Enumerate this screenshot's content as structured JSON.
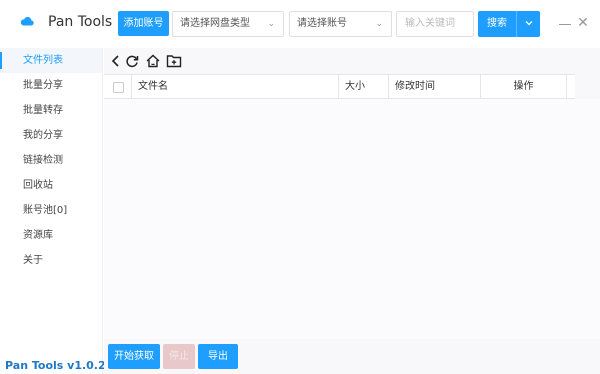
{
  "header": {
    "app_title": "Pan Tools",
    "add_account_label": "添加账号",
    "pan_type_select": {
      "value": "请选择网盘类型"
    },
    "account_select": {
      "value": "请选择账号"
    },
    "keyword_input": {
      "value": "",
      "placeholder": "输入关键词"
    },
    "search_label": "搜索",
    "accent_color": "#1e9fff",
    "icons": [
      "cloud-logo-icon",
      "chevron-down-icon",
      "minimize-icon",
      "close-icon"
    ]
  },
  "sidebar": {
    "items": [
      {
        "label": "文件列表",
        "active": true
      },
      {
        "label": "批量分享",
        "active": false
      },
      {
        "label": "批量转存",
        "active": false
      },
      {
        "label": "我的分享",
        "active": false
      },
      {
        "label": "链接检测",
        "active": false
      },
      {
        "label": "回收站",
        "active": false
      },
      {
        "label": "账号池[0]",
        "active": false
      },
      {
        "label": "资源库",
        "active": false
      },
      {
        "label": "关于",
        "active": false
      }
    ],
    "version": "Pan Tools v1.0.2"
  },
  "toolbar": {
    "icons": [
      "back-icon",
      "refresh-icon",
      "home-icon",
      "new-folder-icon"
    ]
  },
  "table": {
    "columns": [
      "文件名",
      "大小",
      "修改时间",
      "操作"
    ],
    "rows": []
  },
  "actions": {
    "start_label": "开始获取",
    "stop_label": "停止",
    "export_label": "导出"
  }
}
